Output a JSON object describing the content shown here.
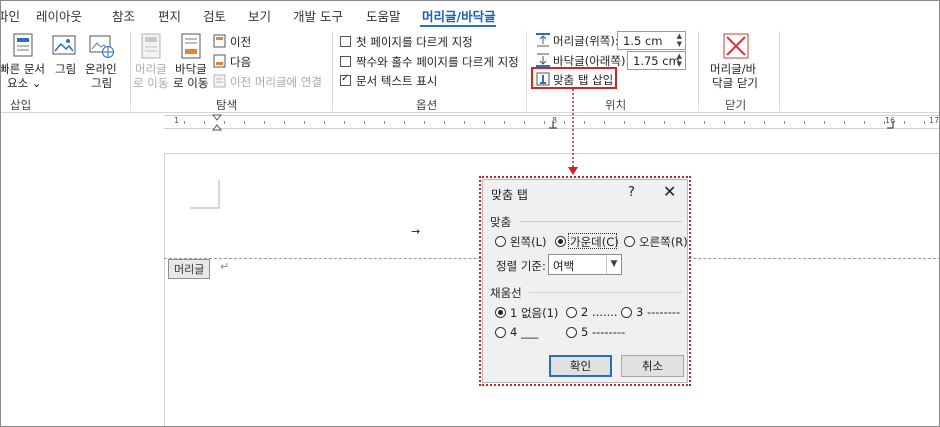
{
  "tabs": [
    "파인",
    "레이아웃",
    "참조",
    "편지",
    "검토",
    "보기",
    "개발 도구",
    "도움말",
    "머리글/바닥글"
  ],
  "ribbon": {
    "insert": {
      "quick_parts": "빠른 문서",
      "quick_parts2": "요소 ⌄",
      "picture": "그림",
      "online": "온라인",
      "online2": "그림",
      "label": "삽입"
    },
    "nav": {
      "goto_header": "머리글",
      "goto_header2": "로 이동",
      "goto_footer": "바닥글",
      "goto_footer2": "로 이동",
      "prev": "이전",
      "next": "다음",
      "link_prev": "이전 머리글에 연결",
      "label": "탐색"
    },
    "options": {
      "first_page": "첫 페이지를 다르게 지정",
      "odd_even": "짝수와 홀수 페이지를 다르게 지정",
      "show_doc_text": "문서 텍스트 표시",
      "label": "옵션"
    },
    "position": {
      "header_top": "머리글(위쪽):",
      "header_top_val": "1.5 cm",
      "footer_bottom": "바닥글(아래쪽):",
      "footer_bottom_val": "1.75 cm",
      "insert_tab": "맞춤 탭 삽입",
      "label": "위치"
    },
    "close": {
      "btn1": "머리글/바",
      "btn2": "닥글 닫기",
      "label": "닫기"
    }
  },
  "ruler_numbers": [
    "1",
    "8",
    "16",
    "17"
  ],
  "document": {
    "header_tag": "머리글",
    "tab_arrow": "→",
    "para_mark": "↵"
  },
  "dialog": {
    "title": "맞춤 탭",
    "help": "?",
    "close": "✕",
    "align_section": "맞춤",
    "align_left": "왼쪽(L)",
    "align_center": "가운데(C)",
    "align_right": "오른쪽(R)",
    "align_base_label": "정렬 기준:",
    "align_base_value": "여백",
    "leader_section": "채움선",
    "leader1": "1 없음(1)",
    "leader2": "2 .......",
    "leader3": "3 --------",
    "leader4": "4 ___",
    "leader5": "5 --------",
    "ok": "확인",
    "cancel": "취소"
  }
}
